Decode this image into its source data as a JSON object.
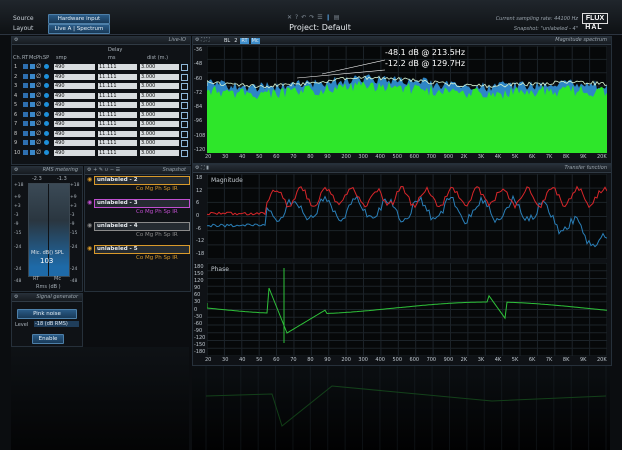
{
  "top": {
    "source_label": "Source",
    "source_value": "Hardware input",
    "layout_label": "Layout",
    "layout_value": "Live A | Spectrum",
    "project_title": "Project: Default",
    "sampling_rate": "Current sampling rate: 44100 Hz",
    "snapshot_info": "Snapshot: \"unlabeled - 4\"",
    "brand_flux": "FLUX",
    "brand_hal": "HAL"
  },
  "live_io": {
    "title": "Live-IO",
    "delay_header": "Delay",
    "col_headers": [
      "Ch.",
      "RT",
      "Mc.",
      "Ph.",
      "SP",
      "smp",
      "ms",
      "dist (m.)"
    ],
    "rows": [
      {
        "ch": "1",
        "smp": "490",
        "ms": "11.111",
        "dist": "3.000"
      },
      {
        "ch": "2",
        "smp": "490",
        "ms": "11.111",
        "dist": "3.000"
      },
      {
        "ch": "3",
        "smp": "490",
        "ms": "11.111",
        "dist": "3.000"
      },
      {
        "ch": "4",
        "smp": "490",
        "ms": "11.111",
        "dist": "3.000"
      },
      {
        "ch": "5",
        "smp": "490",
        "ms": "11.111",
        "dist": "3.000"
      },
      {
        "ch": "6",
        "smp": "490",
        "ms": "11.111",
        "dist": "3.000"
      },
      {
        "ch": "7",
        "smp": "490",
        "ms": "11.111",
        "dist": "3.000"
      },
      {
        "ch": "8",
        "smp": "490",
        "ms": "11.111",
        "dist": "3.000"
      },
      {
        "ch": "9",
        "smp": "490",
        "ms": "11.111",
        "dist": "3.000"
      },
      {
        "ch": "10",
        "smp": "490",
        "ms": "11.111",
        "dist": "3.000"
      }
    ]
  },
  "rms": {
    "title": "RMS metering",
    "peak_left": "-2.3",
    "peak_right": "-1.3",
    "scale": [
      "+18",
      "+9",
      "+3",
      "-3",
      "-9",
      "-15",
      "-24",
      "-24",
      "-48"
    ],
    "reading_label": "Mic. dB() SPL",
    "reading_value": "103",
    "ch_left": "RT",
    "ch_right": "Mc",
    "unit": "Rms (dB )"
  },
  "snapshot": {
    "title": "Snapshot",
    "items": [
      {
        "name": "unlabeled - 2",
        "tags": "Co Mg Ph Sp IR",
        "color": "#d99a2b"
      },
      {
        "name": "unlabeled - 3",
        "tags": "Co Mg Ph Sp IR",
        "color": "#c04fd0"
      },
      {
        "name": "unlabeled - 4",
        "tags": "Co Mg Ph Sp IR",
        "color": "#8a8a8a"
      },
      {
        "name": "unlabeled - 5",
        "tags": "Co Mg Ph Sp IR",
        "color": "#d99a2b"
      }
    ]
  },
  "signal_gen": {
    "title": "Signal generator",
    "noise_value": "Pink noise",
    "level_label": "Level",
    "level_value": "-18 (dB RMS)",
    "enable_label": "Enable"
  },
  "spectrum": {
    "title": "Magnitude spectrum",
    "toolbar": [
      "BL",
      "2",
      "RT",
      "Mc"
    ],
    "marker1": "-48.1 dB @ 213.5Hz",
    "marker2": "-12.2 dB @ 129.7Hz",
    "y_ticks": [
      "-36",
      "-48",
      "-60",
      "-72",
      "-84",
      "-96",
      "-108",
      "-120"
    ],
    "x_ticks": [
      "20",
      "30",
      "40",
      "50",
      "60",
      "70",
      "80",
      "90",
      "200",
      "300",
      "400",
      "500",
      "600",
      "700",
      "900",
      "2K",
      "3K",
      "4K",
      "5K",
      "6K",
      "7K",
      "8K",
      "9K",
      "20K"
    ]
  },
  "transfer": {
    "title": "Transfer function",
    "magnitude_label": "Magnitude",
    "phase_label": "Phase",
    "mag_ticks": [
      "18",
      "12",
      "6",
      "0",
      "-6",
      "-12",
      "-18"
    ],
    "phase_ticks": [
      "180",
      "150",
      "120",
      "90",
      "60",
      "30",
      "0",
      "-30",
      "-60",
      "-90",
      "-120",
      "-150",
      "-180"
    ],
    "x_ticks": [
      "20",
      "30",
      "40",
      "50",
      "60",
      "70",
      "80",
      "90",
      "200",
      "300",
      "400",
      "500",
      "600",
      "700",
      "900",
      "2K",
      "3K",
      "4K",
      "5K",
      "6K",
      "7K",
      "8K",
      "9K",
      "20K"
    ]
  }
}
